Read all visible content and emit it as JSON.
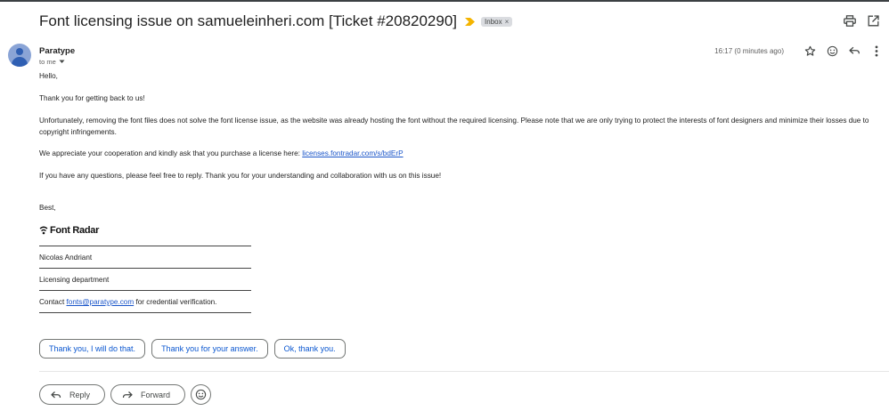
{
  "email": {
    "subject": "Font licensing issue on samueleinheri.com [Ticket #20820290]",
    "label": "Inbox",
    "label_remove": "×",
    "sender": "Paratype",
    "recipient": "to me",
    "timestamp": "16:17 (0 minutes ago)",
    "body": {
      "greeting": "Hello,",
      "thanks": "Thank you for getting back to us!",
      "paragraph1": "Unfortunately, removing the font files does not solve the font license issue, as the website was already hosting the font without the required licensing. Please note that we are only trying to protect the interests of font designers and minimize their losses due to copyright infringements.",
      "paragraph2_prefix": "We appreciate your cooperation and kindly ask that you purchase a license here: ",
      "license_link": "licenses.fontradar.com/s/bdErP",
      "paragraph3": "If you have any questions, please feel free to reply. Thank you for your understanding and collaboration with us on this issue!",
      "signoff": "Best,"
    },
    "signature": {
      "logo_text": "Font Radar",
      "name": "Nicolas Andriant",
      "department": "Licensing department",
      "contact_prefix": "Contact ",
      "contact_email": "fonts@paratype.com",
      "contact_suffix": " for credential verification."
    }
  },
  "smart_replies": [
    "Thank you, I will do that.",
    "Thank you for your answer.",
    "Ok, thank you."
  ],
  "actions": {
    "reply": "Reply",
    "forward": "Forward"
  },
  "icons": {
    "print": "print-icon",
    "open_new_window": "open-in-new-window-icon",
    "star": "star-icon",
    "emoji": "emoji-icon",
    "reply": "reply-icon",
    "more": "more-vert-icon",
    "importance": "importance-marker-icon",
    "dropdown": "chevron-down-icon"
  },
  "colors": {
    "link": "#1a55c9",
    "importance": "#f4b400",
    "chip_text": "#0b57d0",
    "avatar": "#8aa4d6"
  }
}
